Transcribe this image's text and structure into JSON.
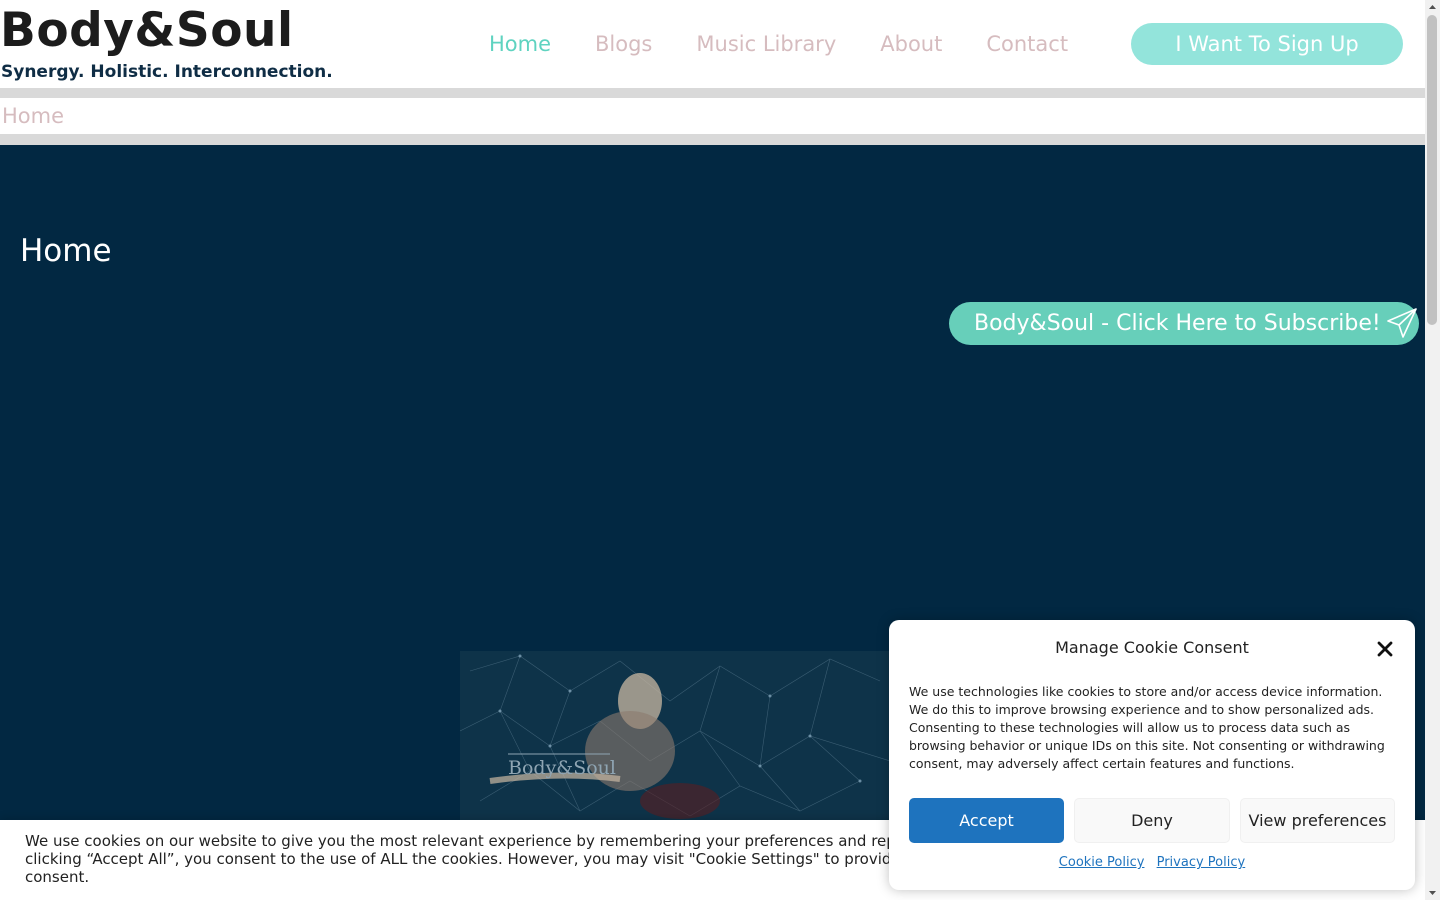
{
  "brand": {
    "title": "Body&Soul",
    "tagline": "Synergy. Holistic. Interconnection."
  },
  "nav": {
    "items": [
      {
        "label": "Home",
        "active": true
      },
      {
        "label": "Blogs",
        "active": false
      },
      {
        "label": "Music Library",
        "active": false
      },
      {
        "label": "About",
        "active": false
      },
      {
        "label": "Contact",
        "active": false
      }
    ],
    "signup_label": "I Want To Sign Up"
  },
  "breadcrumb": {
    "current": "Home"
  },
  "hero": {
    "title": "Home",
    "subscribe_label": "Body&Soul - Click Here to Subscribe!",
    "image_logo_text": "Body&Soul"
  },
  "cookie_banner": {
    "line1": "We use cookies on our website to give you the most relevant experience by remembering your preferences and repeat visits. By",
    "line2": "clicking “Accept All”, you consent to the use of ALL the cookies. However, you may visit \"Cookie Settings\" to provide a controlled",
    "line3": "consent."
  },
  "consent_modal": {
    "title": "Manage Cookie Consent",
    "body": "We use technologies like cookies to store and/or access device information. We do this to improve browsing experience and to show personalized ads. Consenting to these technologies will allow us to process data such as browsing behavior or unique IDs on this site. Not consenting or withdrawing consent, may adversely affect certain features and functions.",
    "accept_label": "Accept",
    "deny_label": "Deny",
    "preferences_label": "View preferences",
    "cookie_policy_label": "Cookie Policy",
    "privacy_policy_label": "Privacy Policy"
  },
  "colors": {
    "accent": "#5fd3c0",
    "nav_inactive": "#d6bcbf",
    "hero_bg": "#022842",
    "primary_button": "#1e73be"
  },
  "icons": [
    "send-icon",
    "close-icon",
    "scroll-up-icon",
    "scroll-down-icon"
  ]
}
